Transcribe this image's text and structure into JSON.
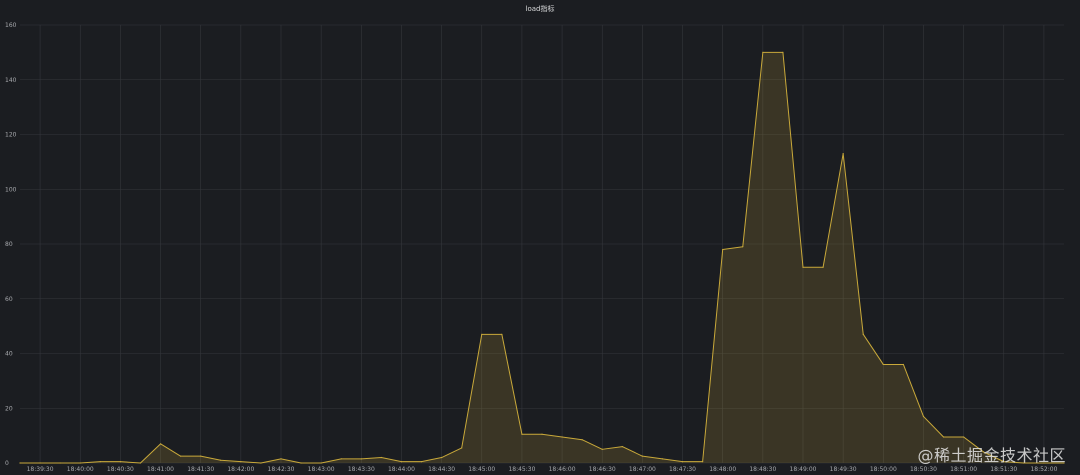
{
  "chart_data": {
    "type": "area",
    "title": "load指标",
    "xlabel": "",
    "ylabel": "",
    "ylim": [
      0,
      160
    ],
    "yticks": [
      0,
      20,
      40,
      60,
      80,
      100,
      120,
      140,
      160
    ],
    "xticks": [
      "18:39:30",
      "18:40:00",
      "18:40:30",
      "18:41:00",
      "18:41:30",
      "18:42:00",
      "18:42:30",
      "18:43:00",
      "18:43:30",
      "18:44:00",
      "18:44:30",
      "18:45:00",
      "18:45:30",
      "18:46:00",
      "18:46:30",
      "18:47:00",
      "18:47:30",
      "18:48:00",
      "18:48:30",
      "18:49:00",
      "18:49:30",
      "18:50:00",
      "18:50:30",
      "18:51:00",
      "18:51:30",
      "18:52:00"
    ],
    "grid": true,
    "series": [
      {
        "name": "",
        "color": "#c9a93a",
        "points": [
          [
            "18:39:15",
            0
          ],
          [
            "18:39:30",
            0
          ],
          [
            "18:39:45",
            0
          ],
          [
            "18:40:00",
            0
          ],
          [
            "18:40:15",
            0.5
          ],
          [
            "18:40:30",
            0.5
          ],
          [
            "18:40:45",
            0
          ],
          [
            "18:41:00",
            7
          ],
          [
            "18:41:15",
            2.5
          ],
          [
            "18:41:30",
            2.5
          ],
          [
            "18:41:45",
            1
          ],
          [
            "18:42:00",
            0.5
          ],
          [
            "18:42:15",
            0
          ],
          [
            "18:42:30",
            1.5
          ],
          [
            "18:42:45",
            0
          ],
          [
            "18:43:00",
            0
          ],
          [
            "18:43:15",
            1.5
          ],
          [
            "18:43:30",
            1.5
          ],
          [
            "18:43:45",
            2
          ],
          [
            "18:44:00",
            0.5
          ],
          [
            "18:44:15",
            0.5
          ],
          [
            "18:44:30",
            2
          ],
          [
            "18:44:45",
            5.5
          ],
          [
            "18:45:00",
            47
          ],
          [
            "18:45:15",
            47
          ],
          [
            "18:45:30",
            10.5
          ],
          [
            "18:45:45",
            10.5
          ],
          [
            "18:46:00",
            9.5
          ],
          [
            "18:46:15",
            8.5
          ],
          [
            "18:46:30",
            5
          ],
          [
            "18:46:45",
            6
          ],
          [
            "18:47:00",
            2.5
          ],
          [
            "18:47:15",
            1.5
          ],
          [
            "18:47:30",
            0.5
          ],
          [
            "18:47:45",
            0.5
          ],
          [
            "18:48:00",
            78
          ],
          [
            "18:48:15",
            79
          ],
          [
            "18:48:30",
            150
          ],
          [
            "18:48:45",
            150
          ],
          [
            "18:49:00",
            71.5
          ],
          [
            "18:49:15",
            71.5
          ],
          [
            "18:49:30",
            113
          ],
          [
            "18:49:45",
            47
          ],
          [
            "18:50:00",
            36
          ],
          [
            "18:50:15",
            36
          ],
          [
            "18:50:30",
            17
          ],
          [
            "18:50:45",
            9.5
          ],
          [
            "18:51:00",
            9.5
          ],
          [
            "18:51:15",
            4
          ],
          [
            "18:51:30",
            0.5
          ],
          [
            "18:51:45",
            0
          ],
          [
            "18:52:00",
            0
          ],
          [
            "18:52:15",
            0
          ]
        ]
      }
    ]
  },
  "watermark": "@稀土掘金技术社区"
}
